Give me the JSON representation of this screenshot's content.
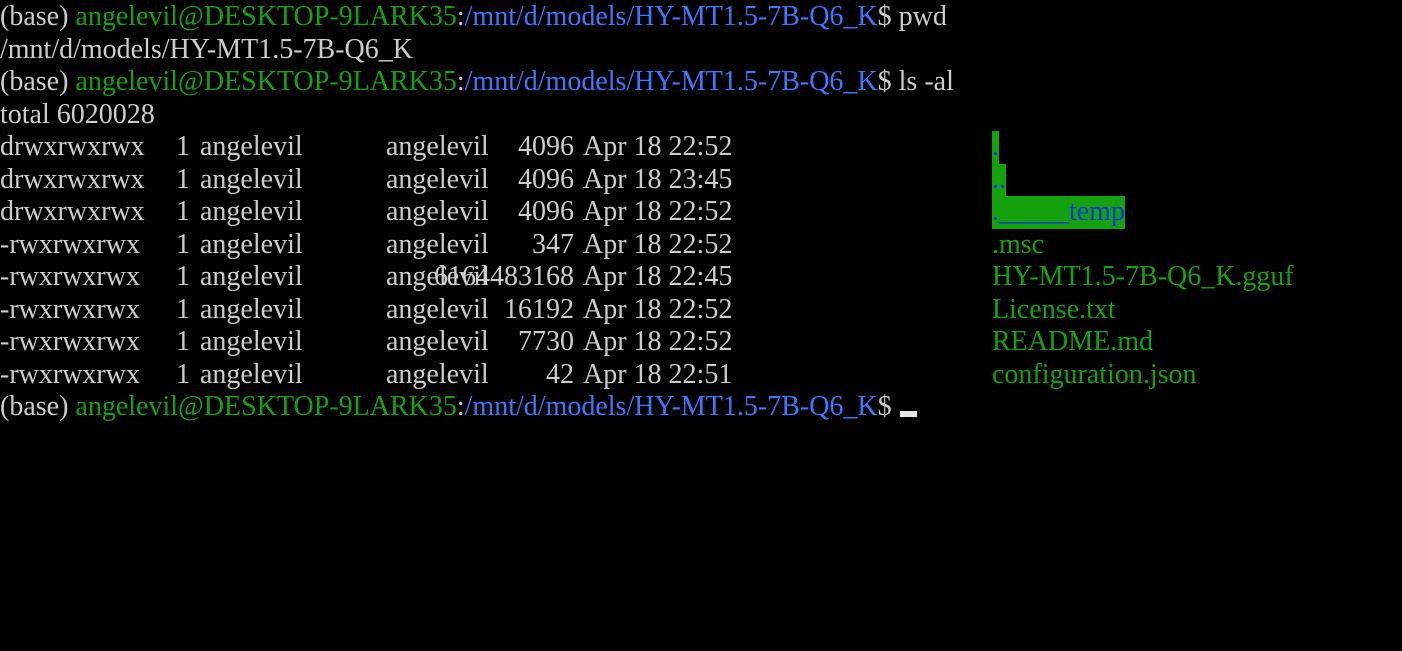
{
  "prompt": {
    "env": "(base) ",
    "user_host": "angelevil@DESKTOP-9LARK35",
    "colon": ":",
    "path": "/mnt/d/models/HY-MT1.5-7B-Q6_K",
    "symbol": "$"
  },
  "commands": [
    "pwd",
    "ls -al"
  ],
  "pwd_output": "/mnt/d/models/HY-MT1.5-7B-Q6_K",
  "total_line": "total 6020028",
  "entries": [
    {
      "perm": "drwxrwxrwx",
      "links": "1",
      "owner": "angelevil",
      "group": "angelevil",
      "size": "4096",
      "date": "Apr 18 22:52",
      "name": ".",
      "type": "dir-highlight"
    },
    {
      "perm": "drwxrwxrwx",
      "links": "1",
      "owner": "angelevil",
      "group": "angelevil",
      "size": "4096",
      "date": "Apr 18 23:45",
      "name": "..",
      "type": "dir-highlight"
    },
    {
      "perm": "drwxrwxrwx",
      "links": "1",
      "owner": "angelevil",
      "group": "angelevil",
      "size": "4096",
      "date": "Apr 18 22:52",
      "name": "._____temp",
      "type": "dir-highlight"
    },
    {
      "perm": "-rwxrwxrwx",
      "links": "1",
      "owner": "angelevil",
      "group": "angelevil",
      "size": "347",
      "date": "Apr 18 22:52",
      "name": ".msc",
      "type": "exec"
    },
    {
      "perm": "-rwxrwxrwx",
      "links": "1",
      "owner": "angelevil",
      "group": "angelevil",
      "size": "6164483168",
      "date": "Apr 18 22:45",
      "name": "HY-MT1.5-7B-Q6_K.gguf",
      "type": "exec"
    },
    {
      "perm": "-rwxrwxrwx",
      "links": "1",
      "owner": "angelevil",
      "group": "angelevil",
      "size": "16192",
      "date": "Apr 18 22:52",
      "name": "License.txt",
      "type": "exec"
    },
    {
      "perm": "-rwxrwxrwx",
      "links": "1",
      "owner": "angelevil",
      "group": "angelevil",
      "size": "7730",
      "date": "Apr 18 22:52",
      "name": "README.md",
      "type": "exec"
    },
    {
      "perm": "-rwxrwxrwx",
      "links": "1",
      "owner": "angelevil",
      "group": "angelevil",
      "size": "42",
      "date": "Apr 18 22:51",
      "name": "configuration.json",
      "type": "exec"
    }
  ],
  "colors": {
    "background": "#000000",
    "text": "#cccccc",
    "user_host": "#13a10e",
    "path": "#3b78ff",
    "dir_highlight_bg": "#13a10e",
    "dir_highlight_fg": "#0037da",
    "exec_file": "#13a10e"
  }
}
